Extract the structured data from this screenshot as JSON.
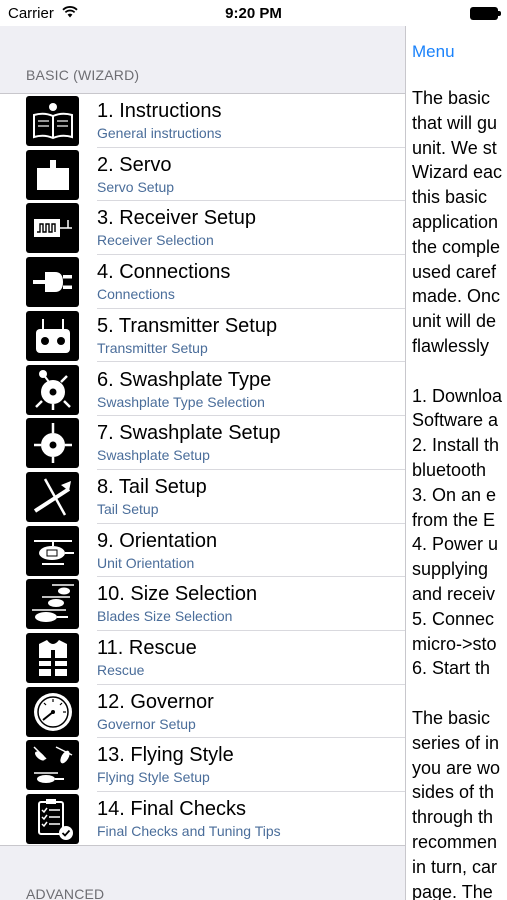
{
  "status_bar": {
    "carrier": "Carrier",
    "time": "9:20 PM"
  },
  "master": {
    "section_basic": "BASIC (WIZARD)",
    "section_advanced": "ADVANCED",
    "items": [
      {
        "title": "1. Instructions",
        "subtitle": "General instructions",
        "icon": "book-icon"
      },
      {
        "title": "2. Servo",
        "subtitle": "Servo Setup",
        "icon": "servo-icon"
      },
      {
        "title": "3. Receiver Setup",
        "subtitle": "Receiver Selection",
        "icon": "receiver-icon"
      },
      {
        "title": "4. Connections",
        "subtitle": "Connections",
        "icon": "plug-icon"
      },
      {
        "title": "5. Transmitter Setup",
        "subtitle": "Transmitter Setup",
        "icon": "transmitter-icon"
      },
      {
        "title": "6. Swashplate Type",
        "subtitle": "Swashplate Type Selection",
        "icon": "swashplate-type-icon"
      },
      {
        "title": "7. Swashplate Setup",
        "subtitle": "Swashplate Setup",
        "icon": "swashplate-setup-icon"
      },
      {
        "title": "8. Tail Setup",
        "subtitle": "Tail Setup",
        "icon": "tail-icon"
      },
      {
        "title": "9. Orientation",
        "subtitle": "Unit Orientation",
        "icon": "orientation-icon"
      },
      {
        "title": "10. Size Selection",
        "subtitle": "Blades Size Selection",
        "icon": "helicopter-sizes-icon"
      },
      {
        "title": "11. Rescue",
        "subtitle": "Rescue",
        "icon": "life-vest-icon"
      },
      {
        "title": "12. Governor",
        "subtitle": "Governor Setup",
        "icon": "gauge-icon"
      },
      {
        "title": "13. Flying Style",
        "subtitle": "Flying Style Setup",
        "icon": "flying-style-icon"
      },
      {
        "title": "14. Final Checks",
        "subtitle": "Final Checks and Tuning Tips",
        "icon": "checklist-icon"
      }
    ]
  },
  "detail": {
    "menu_label": "Menu",
    "paragraphs": [
      [
        "The basic",
        "that will gu",
        "unit. We st",
        "Wizard eac",
        "this basic",
        "application",
        "the comple",
        "used caref",
        "made. Onc",
        "unit will de",
        "flawlessly"
      ],
      [
        "1. Downloa",
        "Software a",
        "2. Install th",
        "bluetooth",
        "3. On an e",
        "from the E",
        "4. Power u",
        "supplying",
        "and receiv",
        "5. Connec",
        "micro->sto",
        "6. Start th"
      ],
      [
        "The basic",
        "series of in",
        "you are wo",
        "sides of th",
        "through th",
        "recommen",
        "in turn, car",
        "page. The"
      ]
    ]
  },
  "colors": {
    "accent": "#1a82fb",
    "subtitle": "#4a6d9a",
    "section_header": "#6d6d72",
    "grouped_bg": "#efeff4"
  }
}
